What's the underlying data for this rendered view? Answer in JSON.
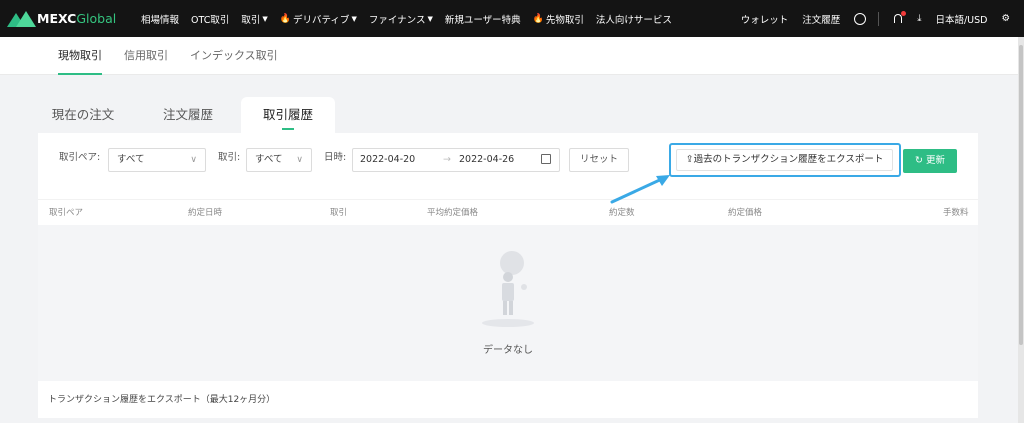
{
  "brand": {
    "name": "MEXC",
    "suffix": "Global"
  },
  "nav": {
    "items": [
      {
        "label": "相場情報",
        "chevron": false,
        "fire": false
      },
      {
        "label": "OTC取引",
        "chevron": false,
        "fire": false
      },
      {
        "label": "取引",
        "chevron": true,
        "fire": false
      },
      {
        "label": "デリバティブ",
        "chevron": true,
        "fire": true
      },
      {
        "label": "ファイナンス",
        "chevron": true,
        "fire": false
      },
      {
        "label": "新規ユーザー特典",
        "chevron": false,
        "fire": false
      },
      {
        "label": "先物取引",
        "chevron": false,
        "fire": true
      },
      {
        "label": "法人向けサービス",
        "chevron": false,
        "fire": false
      }
    ],
    "wallet": "ウォレット",
    "orders": "注文履歴",
    "language": "日本語/USD"
  },
  "subnav": {
    "tabs": [
      "現物取引",
      "信用取引",
      "インデックス取引"
    ],
    "active_index": 0
  },
  "main_tabs": {
    "tabs": [
      "現在の注文",
      "注文履歴",
      "取引履歴"
    ],
    "active_index": 2
  },
  "filters": {
    "pair_label": "取引ペア:",
    "pair_value": "すべて",
    "side_label": "取引:",
    "side_value": "すべて",
    "date_label": "日時:",
    "start_date": "2022-04-20",
    "end_date": "2022-04-26",
    "range_arrow": "→",
    "reset": "リセット",
    "export": "過去のトランザクション履歴をエクスポート",
    "refresh": "更新"
  },
  "table": {
    "columns": [
      "取引ペア",
      "約定日時",
      "取引",
      "平均約定価格",
      "約定数",
      "約定価格",
      "手数料"
    ],
    "rows": [],
    "empty_text": "データなし"
  },
  "footer_note": "トランザクション履歴をエクスポート（最大12ヶ月分）",
  "colors": {
    "accent": "#2ebd85",
    "highlight": "#3aa9e6",
    "nav_bg": "#141414"
  }
}
